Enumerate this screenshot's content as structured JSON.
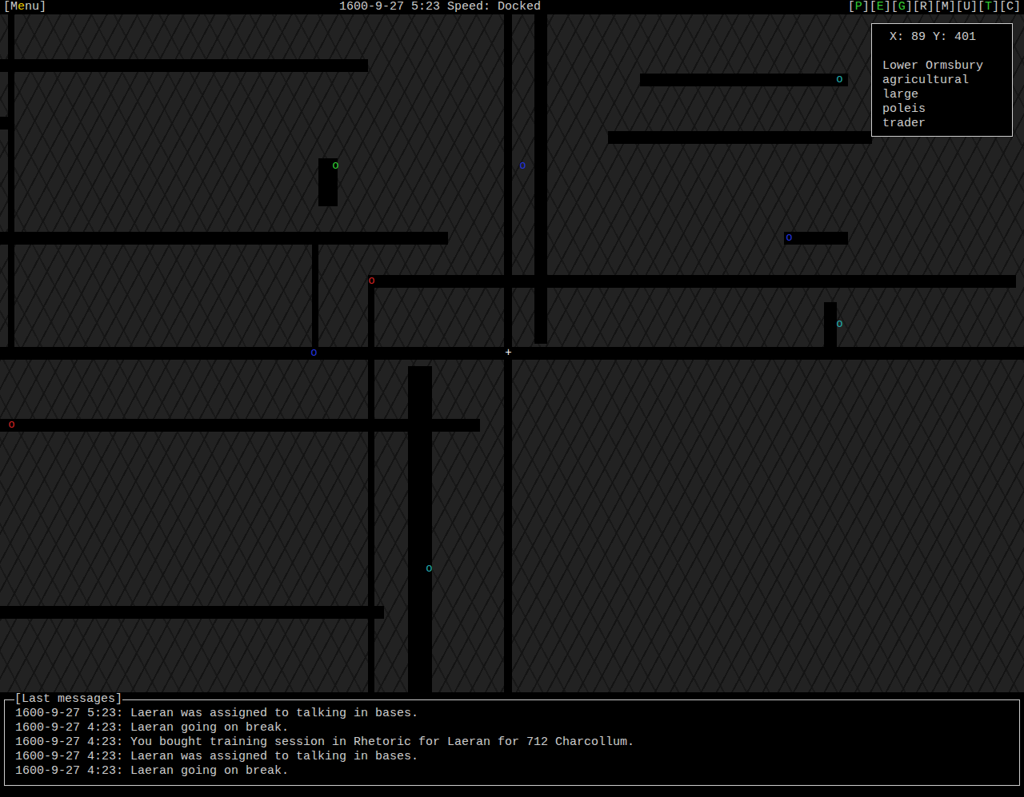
{
  "top_bar": {
    "menu": {
      "open": "[",
      "before": "M",
      "hotkey": "e",
      "after": "nu",
      "close": "]"
    },
    "status": "1600-9-27 5:23 Speed: Docked",
    "panels": [
      {
        "open": "[",
        "key": "P",
        "close": "]",
        "enabled": true
      },
      {
        "open": "[",
        "key": "E",
        "close": "]",
        "enabled": true
      },
      {
        "open": "[",
        "key": "G",
        "close": "]",
        "enabled": true
      },
      {
        "open": "[",
        "key": "R",
        "close": "]",
        "enabled": false
      },
      {
        "open": "[",
        "key": "M",
        "close": "]",
        "enabled": false
      },
      {
        "open": "[",
        "key": "U",
        "close": "]",
        "enabled": false
      },
      {
        "open": "[",
        "key": "T",
        "close": "]",
        "enabled": true
      },
      {
        "open": "[",
        "key": "C",
        "close": "]",
        "enabled": false
      }
    ]
  },
  "info_box": {
    "coordinates": "X: 89 Y: 401",
    "lines": [
      "Lower Ormsbury",
      "agricultural",
      "large",
      "poleis",
      "trader"
    ]
  },
  "map": {
    "cursor": "+",
    "markers": [
      {
        "symbol": "o",
        "color": "#33cc33"
      },
      {
        "symbol": "o",
        "color": "#2233dd"
      },
      {
        "symbol": "o",
        "color": "#cc2222"
      },
      {
        "symbol": "o",
        "color": "#22aaaa"
      },
      {
        "symbol": "o",
        "color": "#2233dd"
      },
      {
        "symbol": "o",
        "color": "#22aaaa"
      },
      {
        "symbol": "o",
        "color": "#2233dd"
      },
      {
        "symbol": "o",
        "color": "#cc2222"
      },
      {
        "symbol": "o",
        "color": "#22aaaa"
      }
    ]
  },
  "messages": {
    "title": "[Last messages]",
    "entries": [
      "1600-9-27 5:23: Laeran was assigned to talking in bases.",
      "1600-9-27 4:23: Laeran going on break.",
      "1600-9-27 4:23: You bought training session in Rhetoric for Laeran for 712 Charcollum.",
      "1600-9-27 4:23: Laeran was assigned to talking in bases.",
      "1600-9-27 4:23: Laeran going on break."
    ]
  }
}
